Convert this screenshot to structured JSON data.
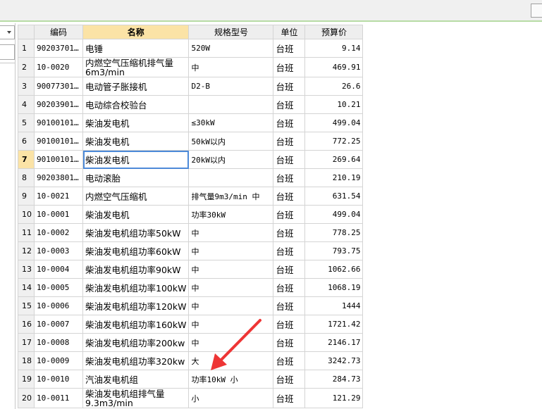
{
  "table": {
    "columns": [
      "",
      "编码",
      "名称",
      "规格型号",
      "单位",
      "预算价"
    ],
    "rows": [
      {
        "n": "1",
        "code": "90203701…",
        "name": "电锤",
        "spec": "520W",
        "unit": "台班",
        "price": "9.14"
      },
      {
        "n": "2",
        "code": "10-0020",
        "name": "内燃空气压缩机排气量6m3/min",
        "spec": "中",
        "unit": "台班",
        "price": "469.91"
      },
      {
        "n": "3",
        "code": "90077301…",
        "name": "电动管子胀接机",
        "spec": "D2-B",
        "unit": "台班",
        "price": "26.6"
      },
      {
        "n": "4",
        "code": "90203901…",
        "name": "电动综合校验台",
        "spec": "",
        "unit": "台班",
        "price": "10.21"
      },
      {
        "n": "5",
        "code": "90100101…",
        "name": "柴油发电机",
        "spec": "≤30kW",
        "unit": "台班",
        "price": "499.04"
      },
      {
        "n": "6",
        "code": "90100101…",
        "name": "柴油发电机",
        "spec": "50kW以内",
        "unit": "台班",
        "price": "772.25"
      },
      {
        "n": "7",
        "code": "90100101…",
        "name": "柴油发电机",
        "spec": "20kW以内",
        "unit": "台班",
        "price": "269.64"
      },
      {
        "n": "8",
        "code": "90203801…",
        "name": "电动滚胎",
        "spec": "",
        "unit": "台班",
        "price": "210.19"
      },
      {
        "n": "9",
        "code": "10-0021",
        "name": "内燃空气压缩机",
        "spec": "排气量9m3/min 中",
        "unit": "台班",
        "price": "631.54"
      },
      {
        "n": "10",
        "code": "10-0001",
        "name": "柴油发电机",
        "spec": "功率30kW",
        "unit": "台班",
        "price": "499.04"
      },
      {
        "n": "11",
        "code": "10-0002",
        "name": "柴油发电机组功率50kW",
        "spec": "中",
        "unit": "台班",
        "price": "778.25"
      },
      {
        "n": "12",
        "code": "10-0003",
        "name": "柴油发电机组功率60kW",
        "spec": "中",
        "unit": "台班",
        "price": "793.75"
      },
      {
        "n": "13",
        "code": "10-0004",
        "name": "柴油发电机组功率90kW",
        "spec": "中",
        "unit": "台班",
        "price": "1062.66"
      },
      {
        "n": "14",
        "code": "10-0005",
        "name": "柴油发电机组功率100kW",
        "spec": "中",
        "unit": "台班",
        "price": "1068.19"
      },
      {
        "n": "15",
        "code": "10-0006",
        "name": "柴油发电机组功率120kW",
        "spec": "中",
        "unit": "台班",
        "price": "1444"
      },
      {
        "n": "16",
        "code": "10-0007",
        "name": "柴油发电机组功率160kW",
        "spec": "中",
        "unit": "台班",
        "price": "1721.42"
      },
      {
        "n": "17",
        "code": "10-0008",
        "name": "柴油发电机组功率200kw",
        "spec": "中",
        "unit": "台班",
        "price": "2146.17"
      },
      {
        "n": "18",
        "code": "10-0009",
        "name": "柴油发电机组功率320kw",
        "spec": "大",
        "unit": "台班",
        "price": "3242.73"
      },
      {
        "n": "19",
        "code": "10-0010",
        "name": "汽油发电机组",
        "spec": "功率10kW 小",
        "unit": "台班",
        "price": "284.73"
      },
      {
        "n": "20",
        "code": "10-0011",
        "name": "柴油发电机组排气量9.3m3/min",
        "spec": "小",
        "unit": "台班",
        "price": "121.29"
      }
    ]
  },
  "selection": {
    "row": "7",
    "column": "名称"
  },
  "colors": {
    "accent_header": "#fbe3a6",
    "selection_border": "#4d8ad8",
    "annotation_arrow": "#ee3535",
    "top_border": "#b7dca5"
  },
  "icons": {
    "combo_arrow": "chevron-down-icon",
    "annotation": "red-arrow-icon"
  }
}
